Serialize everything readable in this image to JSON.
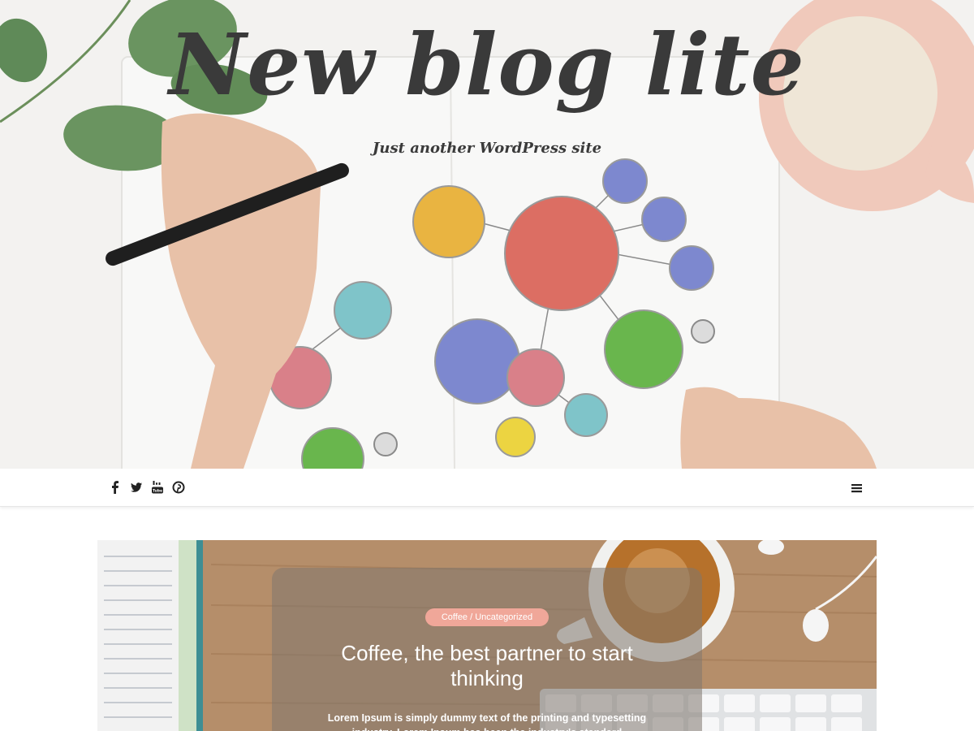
{
  "site": {
    "title": "New blog lite",
    "tagline": "Just another WordPress site"
  },
  "nav": {
    "social": [
      {
        "name": "facebook-icon"
      },
      {
        "name": "twitter-icon"
      },
      {
        "name": "youtube-icon"
      },
      {
        "name": "pinterest-icon"
      }
    ],
    "menu_icon": "hamburger-menu-icon"
  },
  "featured_post": {
    "category": "Coffee / Uncategorized",
    "title": "Coffee, the best partner to start thinking",
    "excerpt": "Lorem Ipsum is simply dummy text of the printing and typesetting industry. Lorem Ipsum has been the industry's standard"
  },
  "colors": {
    "title_text": "#3a3a3a",
    "badge_bg": "#f0a799",
    "navbar_bg": "#ffffff"
  }
}
